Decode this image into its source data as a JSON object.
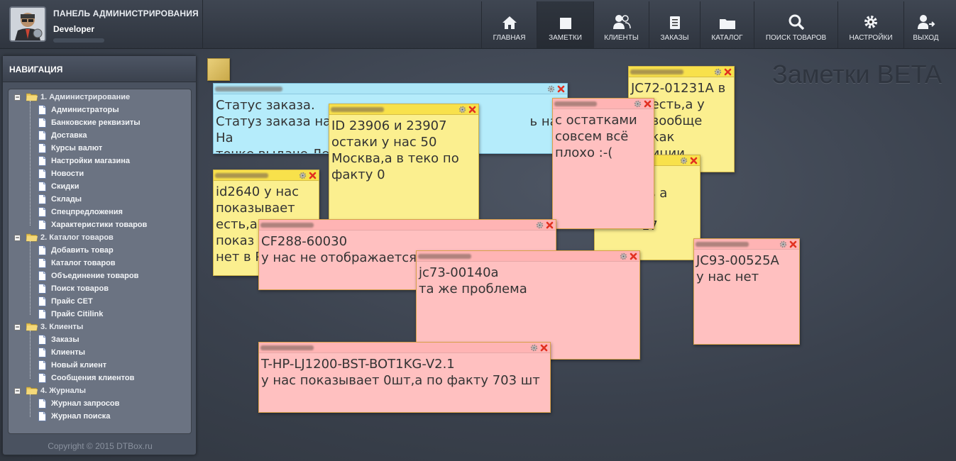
{
  "header": {
    "panel_title": "ПАНЕЛЬ АДМИНИСТРИРОВАНИЯ",
    "user_name": "Developer"
  },
  "nav": [
    {
      "label": "ГЛАВНАЯ",
      "icon": "home-icon"
    },
    {
      "label": "ЗАМЕТКИ",
      "icon": "note-icon",
      "active": true
    },
    {
      "label": "КЛИЕНТЫ",
      "icon": "users-icon"
    },
    {
      "label": "ЗАКАЗЫ",
      "icon": "document-icon"
    },
    {
      "label": "КАТАЛОГ",
      "icon": "folder-icon"
    },
    {
      "label": "ПОИСК ТОВАРОВ",
      "icon": "search-icon"
    },
    {
      "label": "НАСТРОЙКИ",
      "icon": "gear-icon"
    },
    {
      "label": "ВЫХОД",
      "icon": "logout-icon"
    }
  ],
  "sidebar": {
    "title": "НАВИГАЦИЯ",
    "groups": [
      {
        "label": "1. Администрирование",
        "items": [
          "Администраторы",
          "Банковские реквизиты",
          "Доставка",
          "Курсы валют",
          "Настройки магазина",
          "Новости",
          "Скидки",
          "Склады",
          "Спецпредложения",
          "Характеристики товаров"
        ]
      },
      {
        "label": "2. Каталог товаров",
        "items": [
          "Добавить товар",
          "Каталог товаров",
          "Объединение товаров",
          "Поиск товаров",
          "Прайс CET",
          "Прайс Citilink"
        ]
      },
      {
        "label": "3. Клиенты",
        "items": [
          "Заказы",
          "Клиенты",
          "Новый клиент",
          "Сообщения клиентов"
        ]
      },
      {
        "label": "4. Журналы",
        "items": [
          "Журнал запросов",
          "Журнал поиска"
        ]
      }
    ],
    "copyright": "Copyright © 2015 DTBox.ru"
  },
  "page": {
    "title": "Заметки BETA"
  },
  "notes": {
    "n1": {
      "text": "Статус заказа.\nСтатуз заказа на                                                 ь на На\nточке выдаче Лер"
    },
    "n2": {
      "text": "ID 23906 и 23907\nостаки у нас 50\nМосква,а в теко по\nфакту 0"
    },
    "n3": {
      "text": "с остатками\nсовсем всё\nплохо :-("
    },
    "n4": {
      "text": "JC72-01231A в\n     есть,а у\n     вообще\n     как\n     иции"
    },
    "n5": {
      "text": "         8 в\n         сть а\n\n           17"
    },
    "n6": {
      "text": "id2640 у нас\nпоказывает\nесть,а\nпоказ\nнет в Р"
    },
    "n7": {
      "text": "CF288-60030\nу нас не отображается,"
    },
    "n8": {
      "text": "jc73-00140a\nта же проблема"
    },
    "n9": {
      "text": "JC93-00525A\nу нас нет"
    },
    "n10": {
      "text": "T-HP-LJ1200-BST-BOT1KG-V2.1\nу нас показывает 0шт,а по факту 703 шт"
    }
  }
}
